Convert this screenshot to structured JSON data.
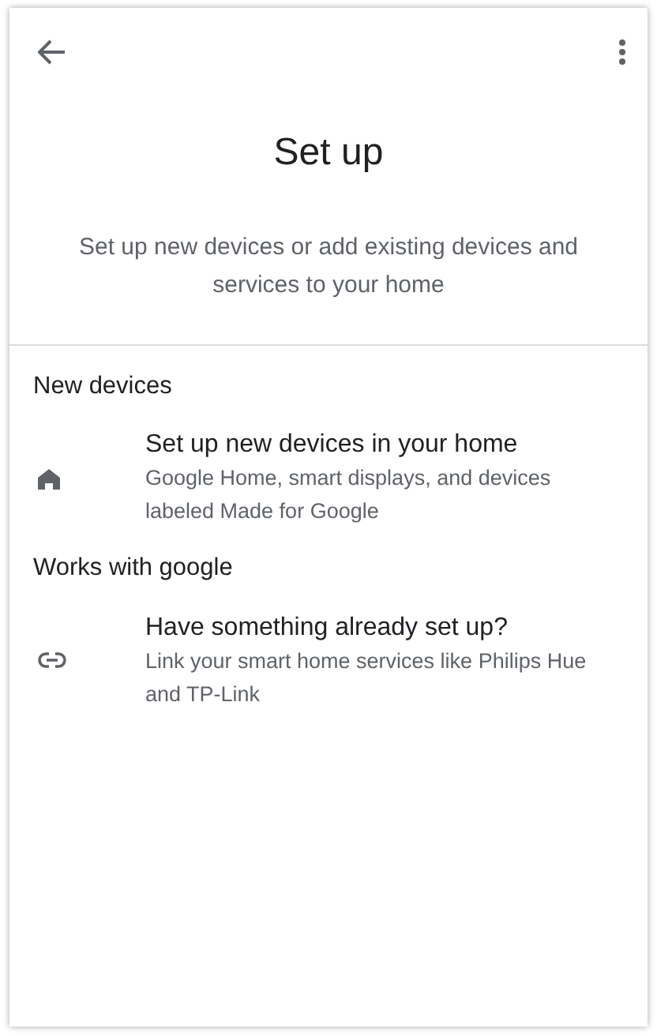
{
  "header": {
    "title": "Set up",
    "subtitle": "Set up new devices or add existing devices and services to your home"
  },
  "sections": [
    {
      "heading": "New devices",
      "items": [
        {
          "kind": "home",
          "title": "Set up new devices in your home",
          "description": "Google Home, smart displays, and devices labeled Made for Google"
        }
      ]
    },
    {
      "heading": "Works with google",
      "items": [
        {
          "kind": "link",
          "title": "Have something already set up?",
          "description": "Link your smart home services like Philips Hue and TP-Link"
        }
      ]
    }
  ]
}
